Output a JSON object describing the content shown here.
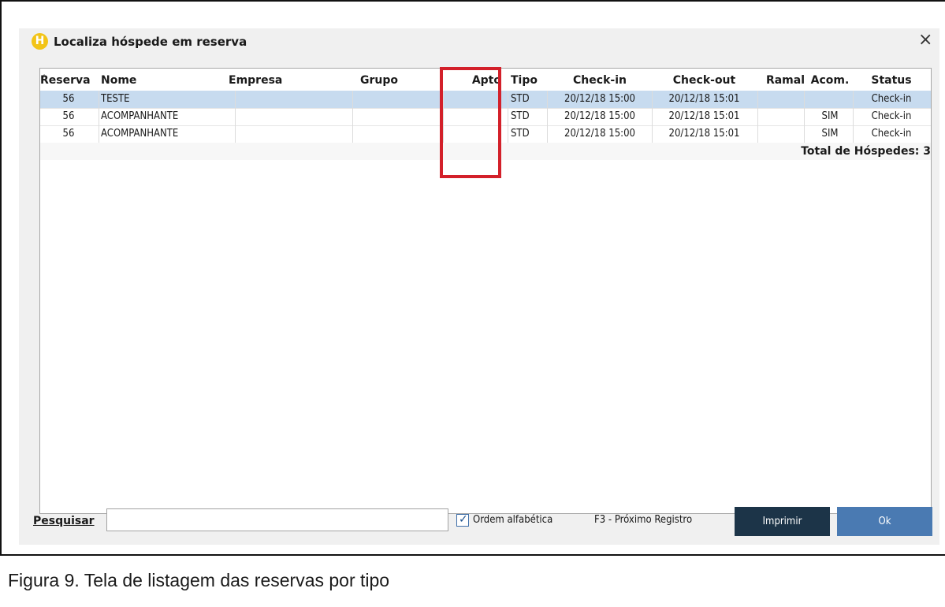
{
  "window": {
    "title": "Localiza hóspede em reserva",
    "app_icon_letter": "H",
    "close_glyph": "×"
  },
  "table": {
    "sort_indicator": "/",
    "columns": [
      "Reserva",
      "Nome",
      "Empresa",
      "Grupo",
      "Apto",
      "Tipo",
      "Check-in",
      "Check-out",
      "Ramal",
      "Acom.",
      "Status"
    ],
    "rows": [
      {
        "reserva": "56",
        "nome": "TESTE",
        "empresa": "",
        "grupo": "",
        "apto": "",
        "tipo": "STD",
        "checkin": "20/12/18 15:00",
        "checkout": "20/12/18 15:01",
        "ramal": "",
        "acom": "",
        "status": "Check-in",
        "selected": true
      },
      {
        "reserva": "56",
        "nome": "ACOMPANHANTE",
        "empresa": "",
        "grupo": "",
        "apto": "",
        "tipo": "STD",
        "checkin": "20/12/18 15:00",
        "checkout": "20/12/18 15:01",
        "ramal": "",
        "acom": "SIM",
        "status": "Check-in",
        "selected": false
      },
      {
        "reserva": "56",
        "nome": "ACOMPANHANTE",
        "empresa": "",
        "grupo": "",
        "apto": "",
        "tipo": "STD",
        "checkin": "20/12/18 15:00",
        "checkout": "20/12/18 15:01",
        "ramal": "",
        "acom": "SIM",
        "status": "Check-in",
        "selected": false
      }
    ],
    "total_label": "Total de Hóspedes: 3"
  },
  "footer": {
    "search_label": "Pesquisar",
    "search_value": "",
    "order_checkbox_label": "Ordem alfabética",
    "order_checked": true,
    "hint": "F3 - Próximo Registro",
    "print_button": "Imprimir",
    "ok_button": "Ok"
  },
  "caption": "Figura 9. Tela de listagem das reservas por tipo",
  "colors": {
    "highlight_box": "#d3202a",
    "selected_row": "#c7dbef",
    "print_button": "#1c3448",
    "ok_button": "#4a7ab2",
    "app_icon": "#f2c417"
  }
}
